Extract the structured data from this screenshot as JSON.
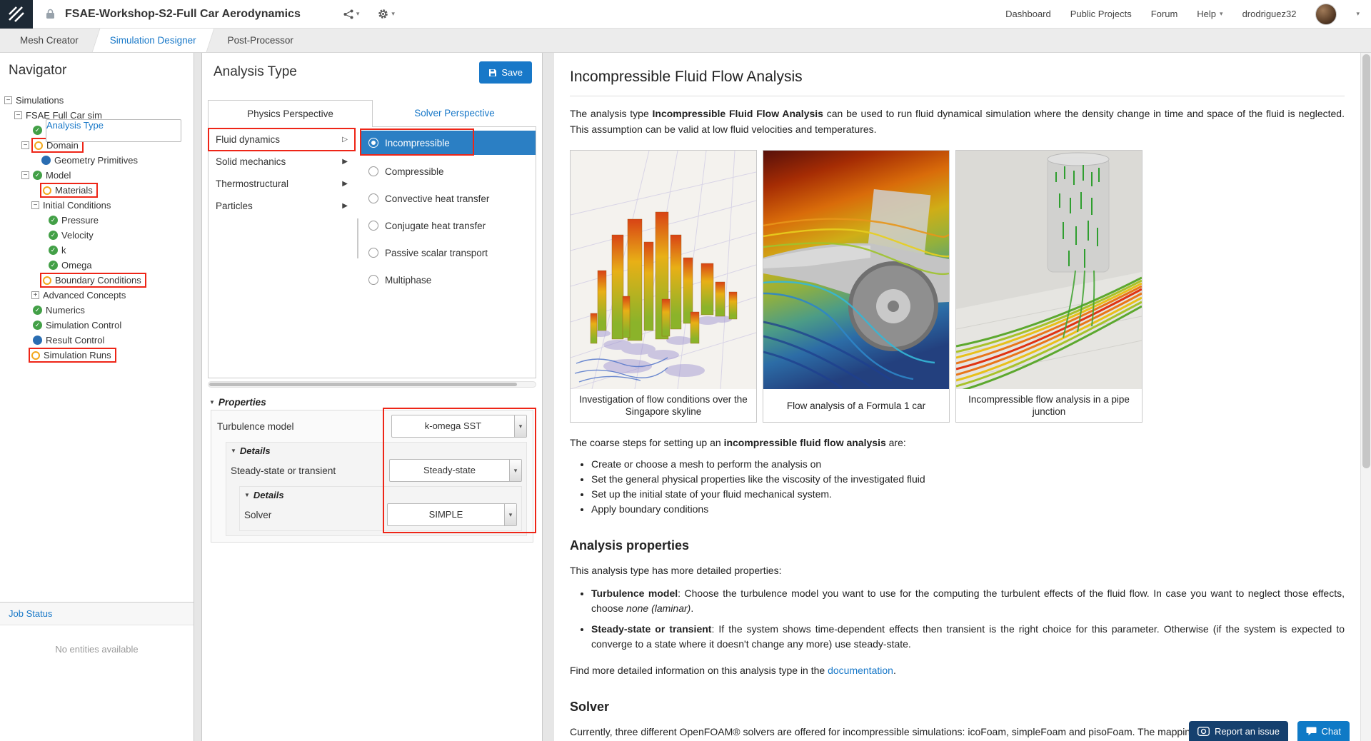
{
  "colors": {
    "accent": "#1878c8",
    "selection": "#2b7fc4",
    "annotation": "#ee2517",
    "check": "#43a047",
    "warning": "#f2a71b",
    "node": "#2a6db2",
    "link": "#1878c8",
    "report_bg": "#15406e",
    "chat_bg": "#0f7ac6"
  },
  "icons": {
    "chevron": "▾",
    "collapse": "−",
    "expand": "+",
    "check": "✓",
    "arrow": "▶",
    "arrow_open": "▷",
    "section": "▼",
    "dropdown": "▾"
  },
  "topbar": {
    "title": "FSAE-Workshop-S2-Full Car Aerodynamics",
    "links": {
      "dashboard": "Dashboard",
      "public_projects": "Public Projects",
      "forum": "Forum",
      "help": "Help",
      "user": "drodriguez32"
    }
  },
  "workbench_tabs": {
    "mesh": "Mesh Creator",
    "sim": "Simulation Designer",
    "post": "Post-Processor"
  },
  "navigator": {
    "title": "Navigator",
    "tree": [
      {
        "label": "Simulations"
      },
      {
        "label": "FSAE Full Car sim"
      },
      {
        "label": "Analysis Type"
      },
      {
        "label": "Domain"
      },
      {
        "label": "Geometry Primitives"
      },
      {
        "label": "Model"
      },
      {
        "label": "Materials"
      },
      {
        "label": "Initial Conditions"
      },
      {
        "label": "Pressure"
      },
      {
        "label": "Velocity"
      },
      {
        "label": "k"
      },
      {
        "label": "Omega"
      },
      {
        "label": "Boundary Conditions"
      },
      {
        "label": "Advanced Concepts"
      },
      {
        "label": "Numerics"
      },
      {
        "label": "Simulation Control"
      },
      {
        "label": "Result Control"
      },
      {
        "label": "Simulation Runs"
      }
    ],
    "job_status": {
      "title": "Job Status",
      "empty": "No entities available"
    }
  },
  "panel": {
    "title": "Analysis Type",
    "save_label": "Save",
    "tabs": {
      "physics": "Physics Perspective",
      "solver": "Solver Perspective"
    },
    "categories": [
      "Fluid dynamics",
      "Solid mechanics",
      "Thermostructural",
      "Particles"
    ],
    "options": [
      "Incompressible",
      "Compressible",
      "Convective heat transfer",
      "Conjugate heat transfer",
      "Passive scalar transport",
      "Multiphase"
    ],
    "properties": {
      "header": "Properties",
      "details_label": "Details",
      "turbulence_label": "Turbulence model",
      "turbulence_value": "k-omega SST",
      "time_label": "Steady-state or transient",
      "time_value": "Steady-state",
      "solver_label": "Solver",
      "solver_value": "SIMPLE"
    }
  },
  "doc": {
    "title": "Incompressible Fluid Flow Analysis",
    "intro_pre": "The analysis type ",
    "intro_bold": "Incompressible Fluid Flow Analysis",
    "intro_post": " can be used to run fluid dynamical simulation where the density change in time and space of the fluid is neglected. This assumption can be valid at low fluid velocities and temperatures.",
    "figures": [
      {
        "caption": "Investigation of flow conditions over the Singapore skyline"
      },
      {
        "caption": "Flow analysis of a Formula 1 car"
      },
      {
        "caption": "Incompressible flow analysis in a pipe junction"
      }
    ],
    "steps_pre": "The coarse steps for setting up an ",
    "steps_bold": "incompressible fluid flow analysis",
    "steps_post": " are:",
    "steps": [
      "Create or choose a mesh to perform the analysis on",
      "Set the general physical properties like the viscosity of the investigated fluid",
      "Set up the initial state of your fluid mechanical system.",
      "Apply boundary conditions"
    ],
    "props_heading": "Analysis properties",
    "props_intro": "This analysis type has more detailed properties:",
    "prop_items": [
      {
        "term": "Turbulence model",
        "desc": ": Choose the turbulence model you want to use for the computing the turbulent effects of the fluid flow. In case you want to neglect those effects, choose ",
        "em": "none (laminar)",
        "post": "."
      },
      {
        "term": "Steady-state or transient",
        "desc": ": If the system shows time-dependent effects then transient is the right choice for this parameter. Otherwise (if the system is expected to converge to a state where it doesn't change any more) use steady-state.",
        "em": "",
        "post": ""
      }
    ],
    "more_pre": "Find more detailed information on this analysis type in the ",
    "more_link": "documentation",
    "more_post": ".",
    "solver_heading": "Solver",
    "solver_text": "Currently, three different OpenFOAM® solvers are offered for incompressible simulations: icoFoam, simpleFoam and pisoFoam. The mapping between the"
  },
  "floating": {
    "report": "Report an issue",
    "chat": "Chat"
  }
}
